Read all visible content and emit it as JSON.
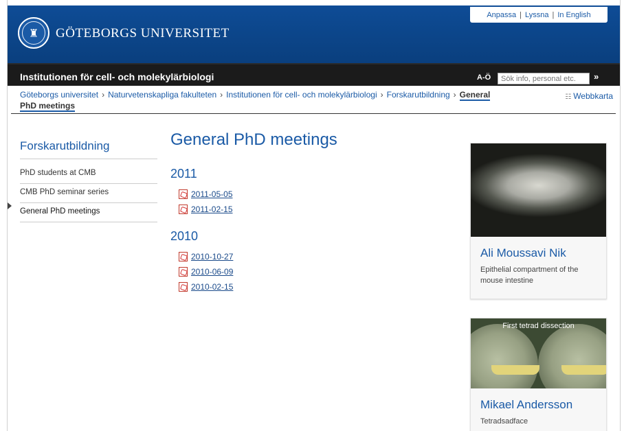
{
  "header": {
    "logo_text": "GÖTEBORGS UNIVERSITET",
    "top_links": [
      "Anpassa",
      "Lyssna",
      "In English"
    ]
  },
  "bar": {
    "title": "Institutionen för cell- och molekylärbiologi",
    "az_label": "A-Ö",
    "search_placeholder": "Sök info, personal etc.",
    "search_go": "»"
  },
  "breadcrumb": {
    "items": [
      "Göteborgs universitet",
      "Naturvetenskapliga fakulteten",
      "Institutionen för cell- och molekylärbiologi",
      "Forskarutbildning"
    ],
    "current_line1": "General",
    "current_line2": "PhD meetings",
    "separator": "›"
  },
  "sitemap_label": "Webbkarta",
  "nav": {
    "title": "Forskarutbildning",
    "items": [
      "PhD students at CMB",
      "CMB PhD seminar series",
      "General PhD meetings"
    ]
  },
  "main": {
    "title": "General PhD meetings",
    "groups": [
      {
        "year": "2011",
        "docs": [
          "2011-05-05",
          "2011-02-15"
        ]
      },
      {
        "year": "2010",
        "docs": [
          "2010-10-27",
          "2010-06-09",
          "2010-02-15"
        ]
      }
    ]
  },
  "cards": [
    {
      "name": "Ali Moussavi Nik",
      "desc": "Epithelial compartment of the mouse intestine"
    },
    {
      "name": "Mikael Andersson",
      "desc": "Tetradsadface",
      "image_caption": "First tetrad dissection"
    }
  ]
}
